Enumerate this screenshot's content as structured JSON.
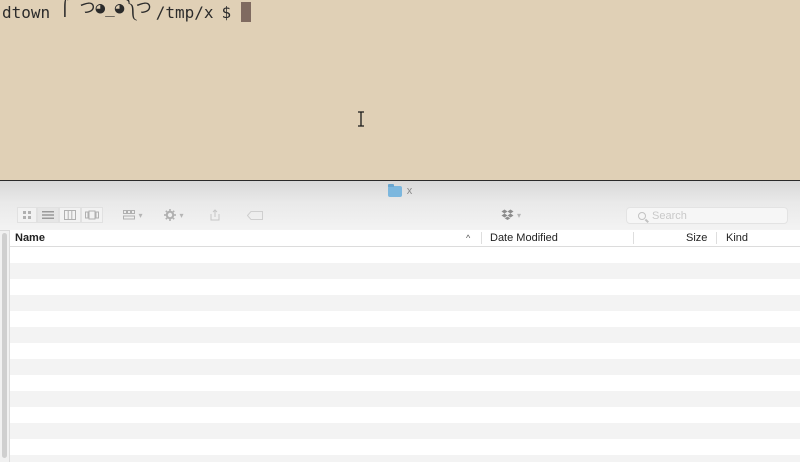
{
  "terminal": {
    "host": "dtown",
    "face": "⌠ つ◕_◕༽つ",
    "path": "/tmp/x",
    "prompt_symbol": "$"
  },
  "finder": {
    "window_title": "x",
    "search": {
      "placeholder": "Search"
    },
    "columns": {
      "name": "Name",
      "date_modified": "Date Modified",
      "size": "Size",
      "kind": "Kind"
    },
    "sort": {
      "column": "Name",
      "direction": "ascending"
    },
    "toolbar": {
      "icons": [
        "icon-view-icon",
        "list-view-icon",
        "column-view-icon",
        "cover-flow-icon",
        "arrange-icon",
        "gear-icon",
        "share-icon",
        "tag-icon",
        "dropbox-icon"
      ]
    }
  }
}
